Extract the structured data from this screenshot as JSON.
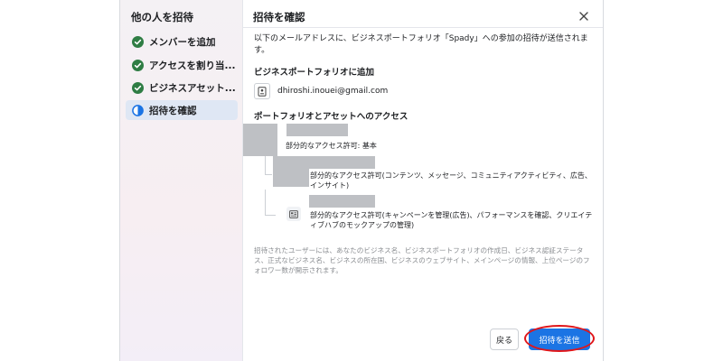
{
  "sidebar": {
    "title": "他の人を招待",
    "steps": [
      {
        "label": "メンバーを追加",
        "state": "done"
      },
      {
        "label": "アクセスを割り当...",
        "state": "done"
      },
      {
        "label": "ビジネスアセット...",
        "state": "done"
      },
      {
        "label": "招待を確認",
        "state": "current"
      }
    ]
  },
  "main": {
    "title": "招待を確認",
    "intro": "以下のメールアドレスに、ビジネスポートフォリオ「Spady」への参加の招待が送信されます。",
    "add_section": {
      "heading": "ビジネスポートフォリオに追加",
      "email": "dhiroshi.inouei@gmail.com"
    },
    "access_section": {
      "heading": "ポートフォリオとアセットへのアクセス",
      "portfolio_access": "部分的なアクセス許可: 基本",
      "assets": [
        {
          "access": "部分的なアクセス許可(コンテンツ、メッセージ、コミュニティアクティビティ、広告、インサイト)"
        },
        {
          "access": "部分的なアクセス許可(キャンペーンを管理(広告)、パフォーマンスを確認、クリエイティブハブのモックアップの管理)"
        }
      ]
    },
    "footer_note": "招待されたユーザーには、あなたのビジネス名、ビジネスポートフォリオの作成日、ビジネス認証ステータス、正式なビジネス名、ビジネスの所在国、ビジネスのウェブサイト、メインページの情報、上位ページのフォロワー数が開示されます。"
  },
  "buttons": {
    "back": "戻る",
    "send": "招待を送信"
  },
  "colors": {
    "accent": "#1b74e4",
    "done_check": "#2f7d44",
    "annotation": "#e0161a"
  }
}
